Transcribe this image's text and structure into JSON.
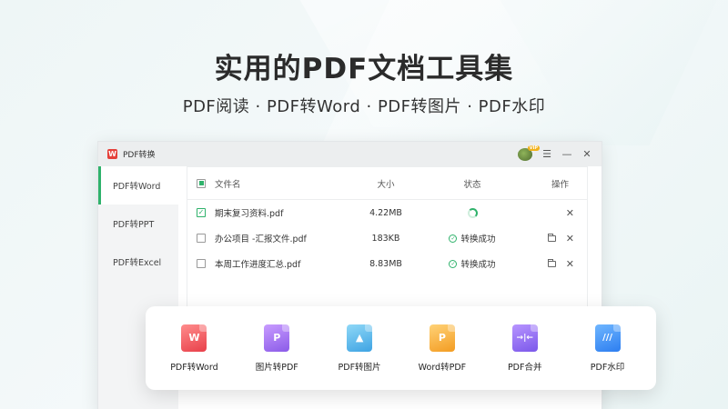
{
  "banner": {
    "title": "实用的PDF文档工具集",
    "subtitle": "PDF阅读 · PDF转Word · PDF转图片 · PDF水印"
  },
  "window": {
    "app_logo_letter": "W",
    "app_title": "PDF转换",
    "vip_badge": "VIP",
    "menu_icon": "☰",
    "minimize_icon": "—",
    "close_icon": "✕"
  },
  "sidebar": {
    "items": [
      {
        "label": "PDF转Word",
        "active": true
      },
      {
        "label": "PDF转PPT",
        "active": false
      },
      {
        "label": "PDF转Excel",
        "active": false
      }
    ]
  },
  "table": {
    "headers": {
      "name": "文件名",
      "size": "大小",
      "status": "状态",
      "actions": "操作"
    },
    "rows": [
      {
        "name": "期末复习资料.pdf",
        "size": "4.22MB",
        "status": "",
        "state": "converting",
        "checked": true
      },
      {
        "name": "办公项目 -汇报文件.pdf",
        "size": "183KB",
        "status": "转换成功",
        "state": "done",
        "checked": false
      },
      {
        "name": "本周工作进度汇总.pdf",
        "size": "8.83MB",
        "status": "转换成功",
        "state": "done",
        "checked": false
      }
    ]
  },
  "tools": [
    {
      "label": "PDF转Word",
      "glyph": "W",
      "color": "#e8404a"
    },
    {
      "label": "图片转PDF",
      "glyph": "P",
      "color": "#8b5be8"
    },
    {
      "label": "PDF转图片",
      "glyph": "▲",
      "color": "#3ea3e3"
    },
    {
      "label": "Word转PDF",
      "glyph": "P",
      "color": "#f39c22"
    },
    {
      "label": "PDF合并",
      "glyph": "→|←",
      "color": "#7b58ea"
    },
    {
      "label": "PDF水印",
      "glyph": "///",
      "color": "#2d7ef0"
    }
  ]
}
